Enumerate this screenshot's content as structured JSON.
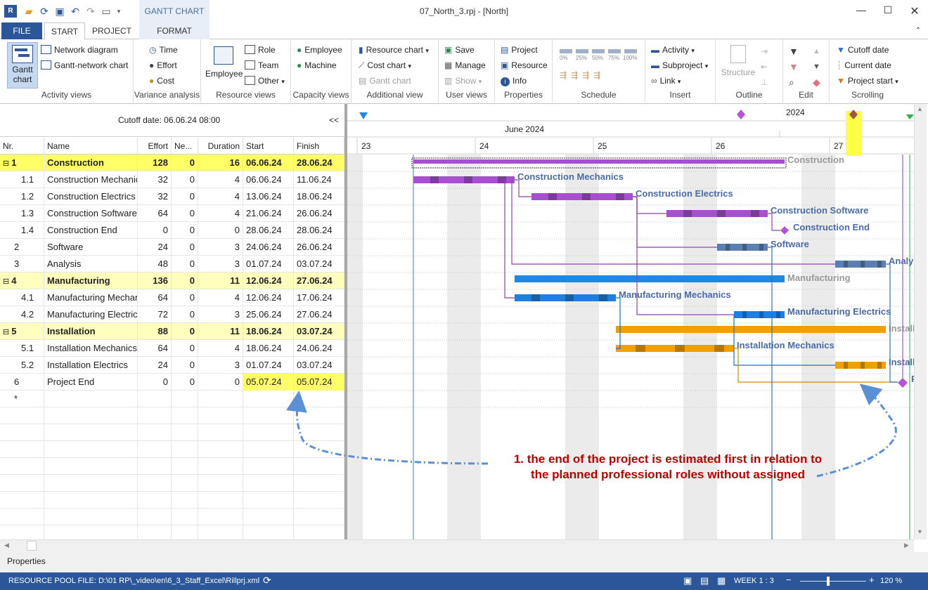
{
  "window": {
    "title": "07_North_3.rpj - [North]",
    "context_tab_header": "GANTT CHART",
    "minimize_icon": "minimize-icon",
    "maximize_icon": "maximize-icon",
    "close_icon": "close-icon"
  },
  "tabs": [
    {
      "label": "FILE"
    },
    {
      "label": "START"
    },
    {
      "label": "PROJECT"
    },
    {
      "label": "FORMAT"
    }
  ],
  "ribbon": {
    "activity_views": {
      "label": "Activity views",
      "gantt": "Gantt chart",
      "network": "Network diagram",
      "gantt_network": "Gantt-network chart"
    },
    "variance_analysis": {
      "label": "Variance analysis",
      "time": "Time",
      "effort": "Effort",
      "cost": "Cost"
    },
    "resource_views": {
      "label": "Resource views",
      "employee": "Employee",
      "role": "Role",
      "team": "Team",
      "other": "Other"
    },
    "capacity_views": {
      "label": "Capacity views",
      "employee": "Employee",
      "machine": "Machine"
    },
    "additional_view": {
      "label": "Additional view",
      "resource_chart": "Resource chart",
      "cost_chart": "Cost chart",
      "gantt_chart": "Gantt chart"
    },
    "user_views": {
      "label": "User views",
      "save": "Save",
      "manage": "Manage",
      "show": "Show"
    },
    "properties": {
      "label": "Properties",
      "project": "Project",
      "resource": "Resource",
      "info": "Info"
    },
    "schedule": {
      "label": "Schedule",
      "pct": [
        "0%",
        "25%",
        "50%",
        "75%",
        "100%"
      ]
    },
    "insert": {
      "label": "Insert",
      "activity": "Activity",
      "subproject": "Subproject",
      "link": "Link"
    },
    "outline": {
      "label": "Outline",
      "structure": "Structure"
    },
    "edit": {
      "label": "Edit"
    },
    "scrolling": {
      "label": "Scrolling",
      "cutoff_date": "Cutoff date",
      "current_date": "Current date",
      "project_start": "Project start"
    }
  },
  "table": {
    "cutoff_label": "Cutoff date:  06.06.24 08:00",
    "collapse": "<<",
    "columns": [
      "Nr.",
      "Name",
      "Effort",
      "Ne...",
      "Duration",
      "Start",
      "Finish"
    ],
    "new_row_marker": "*",
    "rows": [
      {
        "nr": "1",
        "name": "Construction",
        "effort": "128",
        "ne": "0",
        "duration": "16",
        "start": "06.06.24",
        "finish": "28.06.24",
        "summary": true,
        "highlight": true
      },
      {
        "nr": "1.1",
        "name": "Construction Mechanics",
        "effort": "32",
        "ne": "0",
        "duration": "4",
        "start": "06.06.24",
        "finish": "11.06.24"
      },
      {
        "nr": "1.2",
        "name": "Construction Electrics",
        "effort": "32",
        "ne": "0",
        "duration": "4",
        "start": "13.06.24",
        "finish": "18.06.24"
      },
      {
        "nr": "1.3",
        "name": "Construction Software",
        "effort": "64",
        "ne": "0",
        "duration": "4",
        "start": "21.06.24",
        "finish": "26.06.24"
      },
      {
        "nr": "1.4",
        "name": "Construction End",
        "effort": "0",
        "ne": "0",
        "duration": "0",
        "start": "28.06.24",
        "finish": "28.06.24"
      },
      {
        "nr": "2",
        "name": "Software",
        "effort": "24",
        "ne": "0",
        "duration": "3",
        "start": "24.06.24",
        "finish": "26.06.24"
      },
      {
        "nr": "3",
        "name": "Analysis",
        "effort": "48",
        "ne": "0",
        "duration": "3",
        "start": "01.07.24",
        "finish": "03.07.24"
      },
      {
        "nr": "4",
        "name": "Manufacturing",
        "effort": "136",
        "ne": "0",
        "duration": "11",
        "start": "12.06.24",
        "finish": "27.06.24",
        "summary": true
      },
      {
        "nr": "4.1",
        "name": "Manufacturing Mechanics",
        "effort": "64",
        "ne": "0",
        "duration": "4",
        "start": "12.06.24",
        "finish": "17.06.24"
      },
      {
        "nr": "4.2",
        "name": "Manufacturing Electrics",
        "effort": "72",
        "ne": "0",
        "duration": "3",
        "start": "25.06.24",
        "finish": "27.06.24"
      },
      {
        "nr": "5",
        "name": "Installation",
        "effort": "88",
        "ne": "0",
        "duration": "11",
        "start": "18.06.24",
        "finish": "03.07.24",
        "summary": true
      },
      {
        "nr": "5.1",
        "name": "Installation Mechanics",
        "effort": "64",
        "ne": "0",
        "duration": "4",
        "start": "18.06.24",
        "finish": "24.06.24"
      },
      {
        "nr": "5.2",
        "name": "Installation Electrics",
        "effort": "24",
        "ne": "0",
        "duration": "3",
        "start": "01.07.24",
        "finish": "03.07.24"
      },
      {
        "nr": "6",
        "name": "Project End",
        "effort": "0",
        "ne": "0",
        "duration": "0",
        "start": "05.07.24",
        "finish": "05.07.24",
        "date_highlight": true
      }
    ]
  },
  "gantt": {
    "year": "2024",
    "month": "June 2024",
    "weeks": [
      "23",
      "24",
      "25",
      "26",
      "27"
    ],
    "labels": {
      "construction": "Construction",
      "construction_mechanics": "Construction Mechanics",
      "construction_electrics": "Construction Electrics",
      "construction_software": "Construction Software",
      "construction_end": "Construction End",
      "software": "Software",
      "analysis": "Analysis",
      "manufacturing": "Manufacturing",
      "manufacturing_mechanics": "Manufacturing Mechanics",
      "manufacturing_electrics": "Manufacturing Electrics",
      "installation": "Installation",
      "installation_mechanics": "Installation Mechanics",
      "installation_electrics": "Installation Electric",
      "project_end": "Project End"
    },
    "colors": {
      "purple": "#a64fd0",
      "blue": "#1f7fe0",
      "steel": "#5b7fb0",
      "orange": "#f0a000",
      "summary_blue": "#1e88e5"
    }
  },
  "annotation": {
    "line1": "1. the end of the project is estimated first in relation to",
    "line2": "the planned professional roles without assigned"
  },
  "properties_label": "Properties",
  "status": {
    "pool_file": "RESOURCE POOL FILE: D:\\01 RP\\_video\\en\\6_3_Staff_Excel\\Rillprj.xml",
    "week": "WEEK 1 : 3",
    "zoom": "120 %",
    "minus": "−",
    "plus": "+"
  }
}
